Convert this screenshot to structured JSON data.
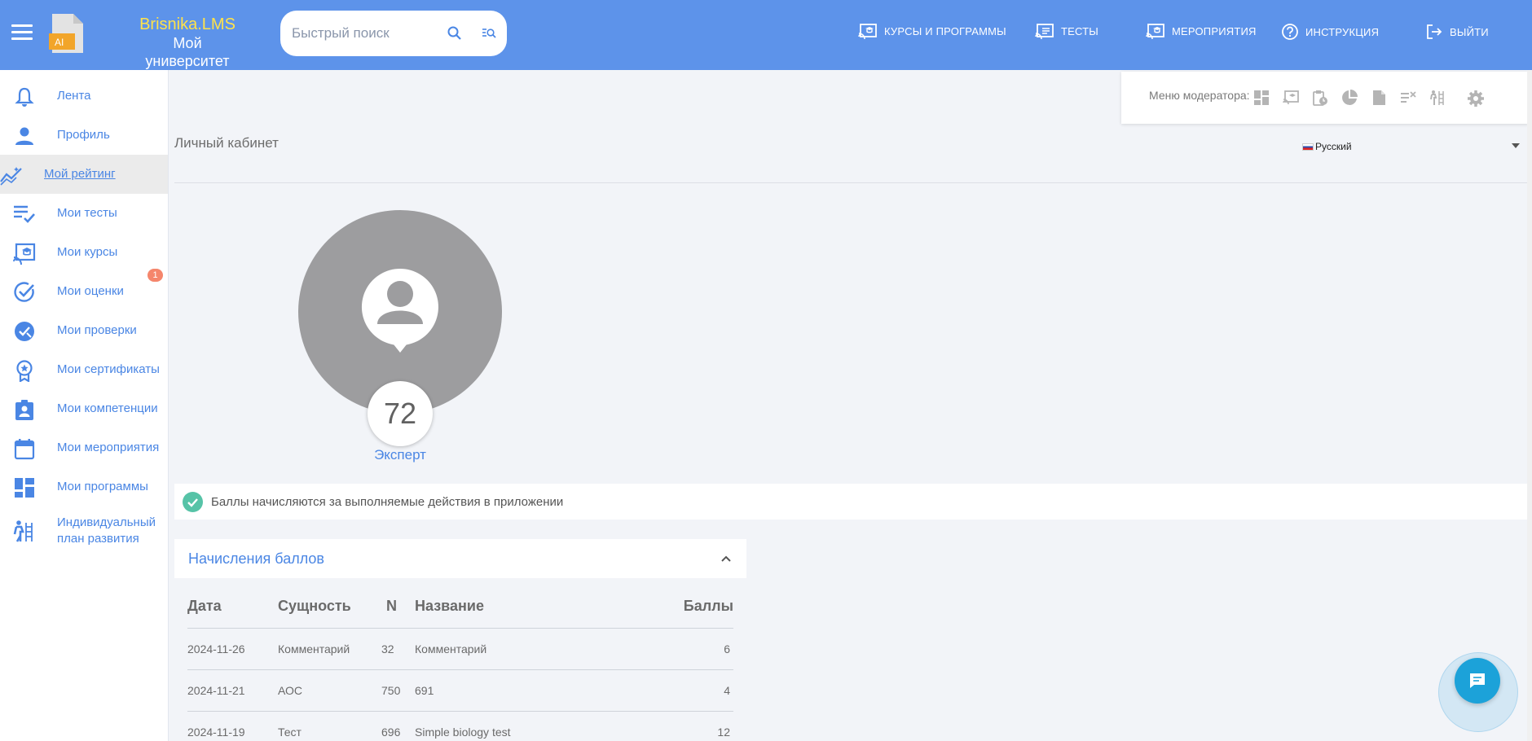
{
  "header": {
    "brand_line1": "Brisnika.LMS",
    "brand_line2": "Мой университет",
    "logo_badge": "AI",
    "search_placeholder": "Быстрый поиск",
    "nav": [
      {
        "label": "КУРСЫ И ПРОГРАММЫ",
        "icon": "cast-course-icon"
      },
      {
        "label": "ТЕСТЫ",
        "icon": "cast-tests-icon"
      },
      {
        "label": "МЕРОПРИЯТИЯ",
        "icon": "cast-events-icon"
      },
      {
        "label": "ИНСТРУКЦИЯ",
        "icon": "help-circle-icon"
      },
      {
        "label": "ВЫЙТИ",
        "icon": "logout-icon"
      }
    ]
  },
  "sidebar": {
    "items": [
      {
        "label": "Лента",
        "icon": "bell-icon"
      },
      {
        "label": "Профиль",
        "icon": "person-icon"
      },
      {
        "label": "Мой рейтинг",
        "icon": "trending-chart-icon",
        "active": true
      },
      {
        "label": "Мои тесты",
        "icon": "list-check-icon"
      },
      {
        "label": "Мои курсы",
        "icon": "cast-course-icon"
      },
      {
        "label": "Мои оценки",
        "icon": "check-circle-icon"
      },
      {
        "label": "Мои проверки",
        "icon": "verified-icon"
      },
      {
        "label": "Мои сертификаты",
        "icon": "award-icon"
      },
      {
        "label": "Мои компетенции",
        "icon": "badge-person-icon"
      },
      {
        "label": "Мои мероприятия",
        "icon": "calendar-icon"
      },
      {
        "label": "Мои программы",
        "icon": "dashboard-icon"
      },
      {
        "label": "Индивидуальный план развития",
        "icon": "climb-icon"
      }
    ],
    "grades_badge": "1"
  },
  "moderator": {
    "label": "Меню модератора:",
    "icons": [
      "dashboard-icon",
      "cast-icon",
      "clipboard-clock-icon",
      "pie-chart-icon",
      "document-icon",
      "list-x-icon",
      "climb-icon",
      "gear-icon"
    ]
  },
  "main": {
    "page_title": "Личный кабинет",
    "language": "Русский",
    "score": "72",
    "level": "Эксперт",
    "info_text": "Баллы начисляются за выполняемые действия в приложении",
    "colors": {
      "accent": "#5d93ea",
      "link": "#4a86e4",
      "brand_yellow": "#ffe24a",
      "success": "#56c3a7",
      "badge": "#f5866c",
      "fab": "#1ca2d9"
    }
  },
  "points": {
    "title": "Начисления баллов",
    "columns": [
      "Дата",
      "Сущность",
      "N",
      "Название",
      "Баллы"
    ],
    "rows": [
      [
        "2024-11-26",
        "Комментарий",
        "32",
        "Комментарий",
        "6"
      ],
      [
        "2024-11-21",
        "АОС",
        "750",
        "691",
        "4"
      ],
      [
        "2024-11-19",
        "Тест",
        "696",
        "Simple biology test",
        "12"
      ]
    ]
  }
}
